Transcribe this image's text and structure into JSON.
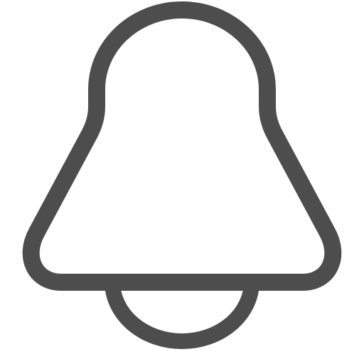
{
  "icon": {
    "name": "bell-icon",
    "stroke_color": "#4d4d4d",
    "fill_color": "#ffffff",
    "background_color": "#ffffff"
  }
}
